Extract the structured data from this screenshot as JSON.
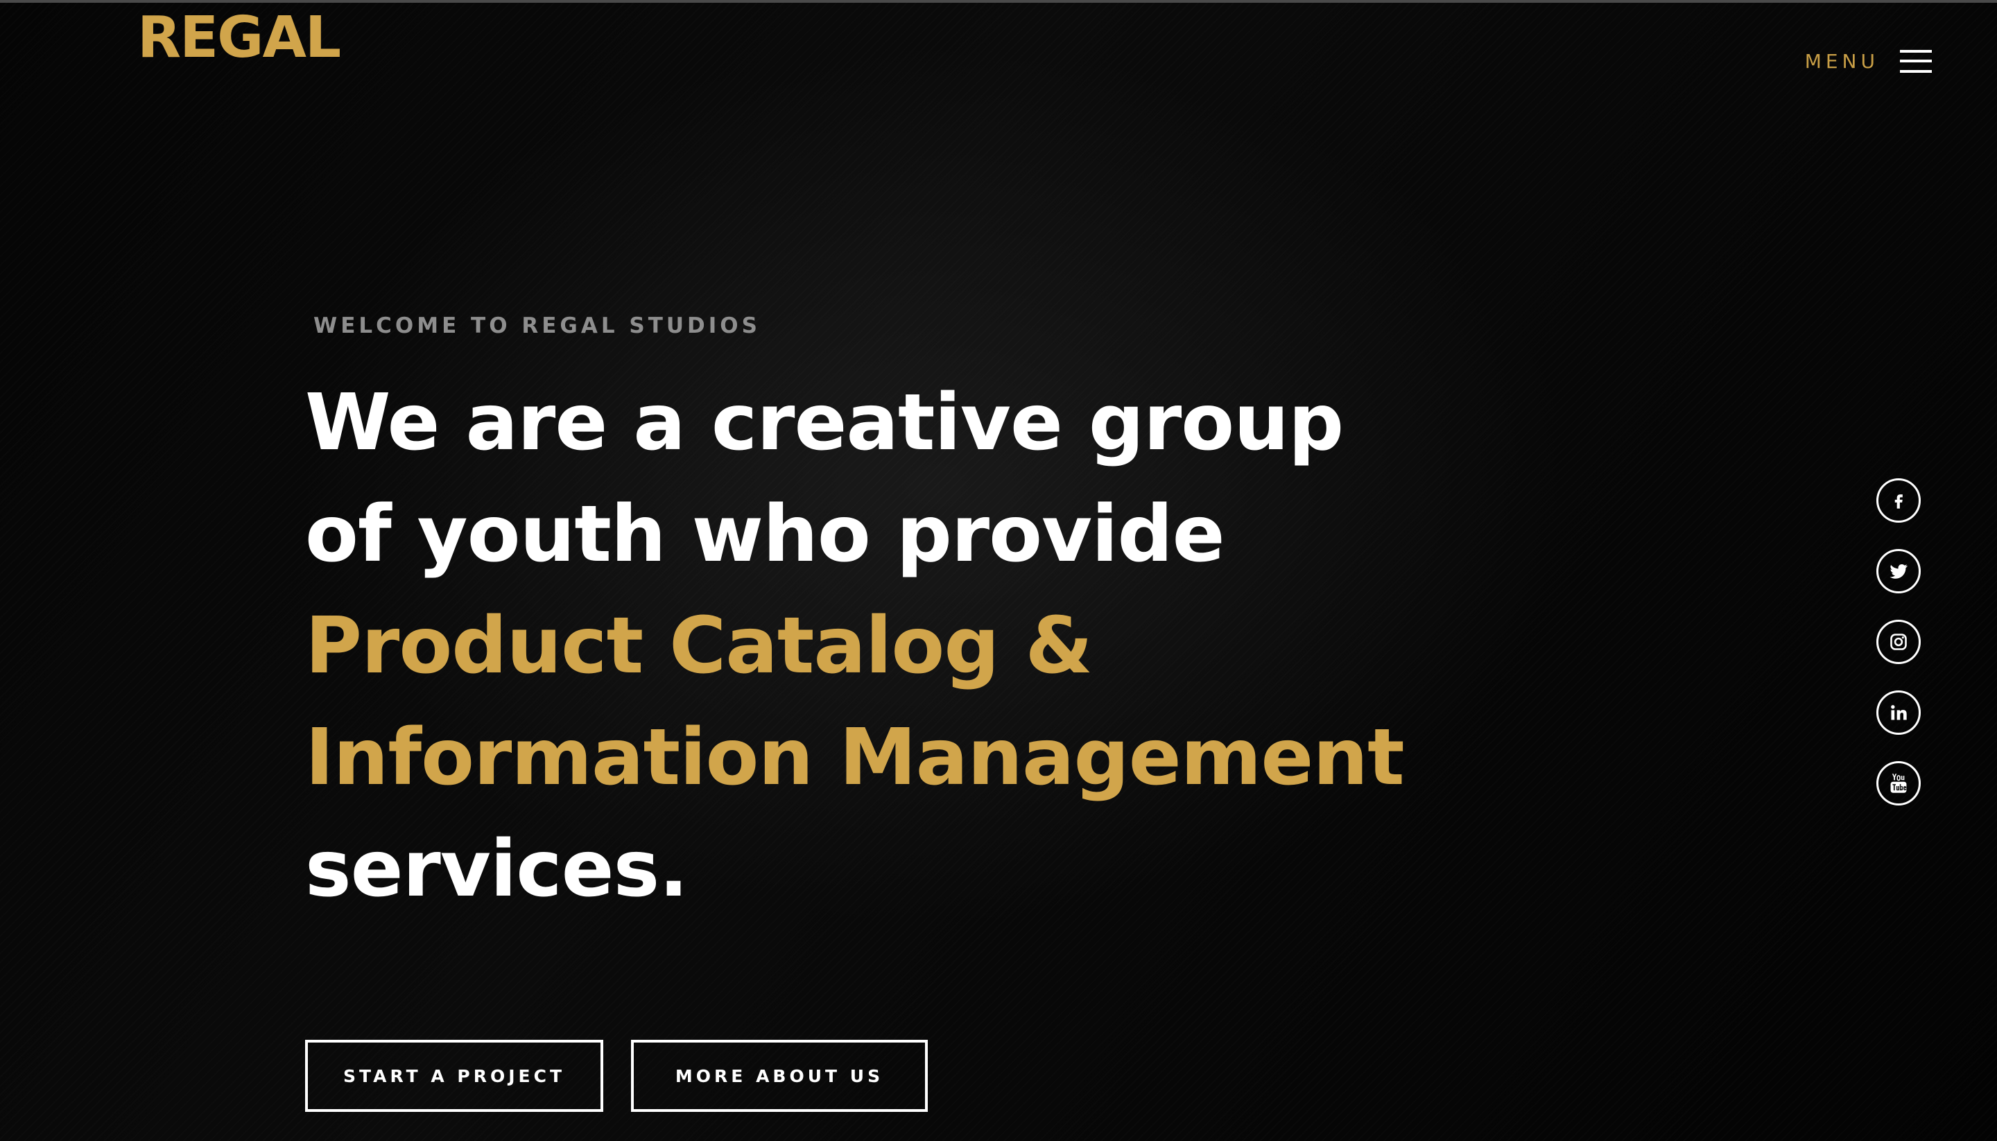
{
  "header": {
    "logo": "REGAL",
    "menu_label": "MENU"
  },
  "hero": {
    "eyebrow": "WELCOME TO REGAL STUDIOS",
    "lines": [
      "We are a creative group",
      "of youth who provide",
      "Product Catalog &",
      "Information Management",
      "services."
    ]
  },
  "buttons": {
    "start": "START A PROJECT",
    "more": "MORE ABOUT US"
  },
  "social": {
    "icons": [
      "facebook-icon",
      "twitter-icon",
      "instagram-icon",
      "linkedin-icon",
      "youtube-icon"
    ]
  },
  "colors": {
    "accent_gold": "#d1a54b",
    "background": "#050505",
    "text": "#ffffff",
    "eyebrow": "#8e8e8e"
  }
}
